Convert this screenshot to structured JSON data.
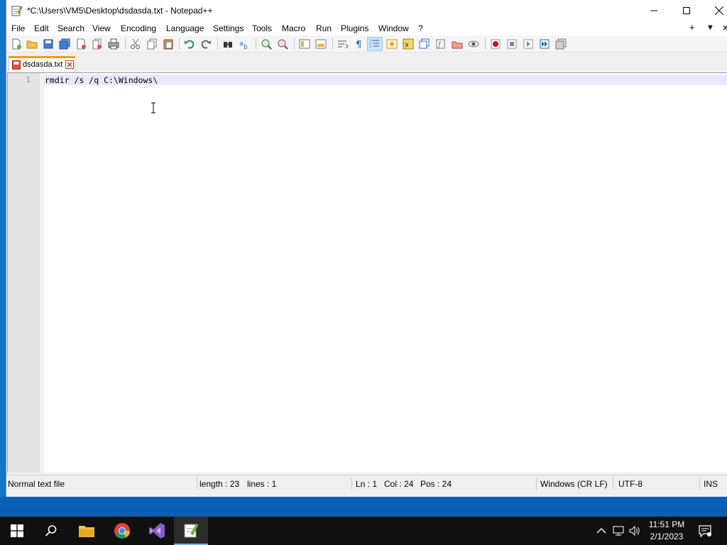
{
  "window": {
    "title": "*C:\\Users\\VM5\\Desktop\\dsdasda.txt - Notepad++"
  },
  "menu": {
    "items": [
      "File",
      "Edit",
      "Search",
      "View",
      "Encoding",
      "Language",
      "Settings",
      "Tools",
      "Macro",
      "Run",
      "Plugins",
      "Window",
      "?"
    ],
    "right_plus": "+",
    "right_arrow": "▼",
    "right_close": "✕"
  },
  "tab": {
    "label": "dsdasda.txt"
  },
  "editor": {
    "lines": [
      {
        "number": "1",
        "text": "rmdir /s /q C:\\Windows\\"
      }
    ]
  },
  "status": {
    "file_type": "Normal text file",
    "length": "length : 23",
    "lines": "lines : 1",
    "ln": "Ln : 1",
    "col": "Col : 24",
    "pos": "Pos : 24",
    "eol": "Windows (CR LF)",
    "encoding": "UTF-8",
    "mode": "INS"
  },
  "taskbar": {
    "time": "11:51 PM",
    "date": "2/1/2023",
    "pinned": [
      "start-icon",
      "search-icon",
      "file-explorer-icon",
      "chrome-icon",
      "visual-studio-icon",
      "notepad-plus-plus-icon"
    ]
  },
  "colors": {
    "tab_accent": "#f39c12",
    "current_line": "#e8e8ff",
    "taskbar": "#101010",
    "desktop": "#0a6ac0"
  }
}
